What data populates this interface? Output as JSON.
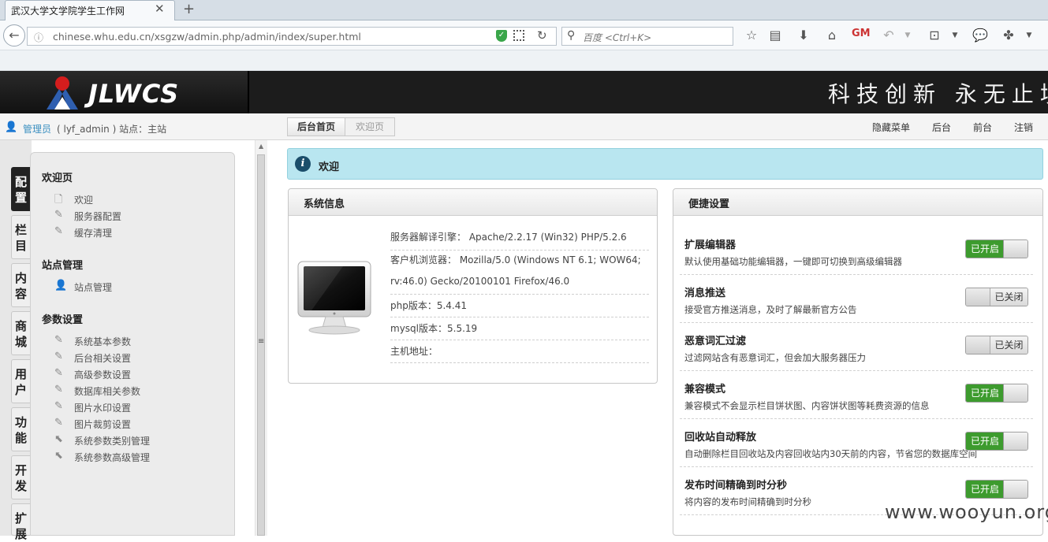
{
  "browser": {
    "tab_title": "武汉大学文学院学生工作网",
    "tab_close": "✕",
    "new_tab": "+",
    "url": "chinese.whu.edu.cn/xsgzw/admin.php/admin/index/super.html",
    "search_placeholder": "百度 <Ctrl+K>"
  },
  "header": {
    "logo_text": "JLWCS",
    "slogan": "科技创新 永无止境"
  },
  "infobar": {
    "user_role": "管理员",
    "user_rest": "( lyf_admin ) 站点：主站",
    "breadcrumb": [
      "后台首页",
      "欢迎页"
    ],
    "links": [
      "隐藏菜单",
      "后台",
      "前台",
      "注销"
    ]
  },
  "sidebar": {
    "tabs": [
      "配置",
      "栏目",
      "内容",
      "商城",
      "用户",
      "功能",
      "开发",
      "扩展"
    ],
    "sections": [
      {
        "title": "欢迎页",
        "items": [
          "欢迎",
          "服务器配置",
          "缓存清理"
        ]
      },
      {
        "title": "站点管理",
        "items": [
          "站点管理"
        ]
      },
      {
        "title": "参数设置",
        "items": [
          "系统基本参数",
          "后台相关设置",
          "高级参数设置",
          "数据库相关参数",
          "图片水印设置",
          "图片裁剪设置",
          "系统参数类别管理",
          "系统参数高级管理"
        ]
      }
    ]
  },
  "welcome": {
    "text": "欢迎"
  },
  "system_info": {
    "title": "系统信息",
    "lines": [
      "服务器解译引擎： Apache/2.2.17 (Win32) PHP/5.2.6",
      "客户机浏览器： Mozilla/5.0 (Windows NT 6.1; WOW64;",
      "rv:46.0) Gecko/20100101 Firefox/46.0",
      "php版本：5.4.41",
      "mysql版本：5.5.19",
      "主机地址："
    ]
  },
  "quick_settings": {
    "title": "便捷设置",
    "items": [
      {
        "title": "扩展编辑器",
        "desc": "默认使用基础功能编辑器，一键即可切换到高级编辑器",
        "state": "已开启",
        "on": true
      },
      {
        "title": "消息推送",
        "desc": "接受官方推送消息，及时了解最新官方公告",
        "state": "已关闭",
        "on": false
      },
      {
        "title": "恶意词汇过滤",
        "desc": "过滤网站含有恶意词汇，但会加大服务器压力",
        "state": "已关闭",
        "on": false
      },
      {
        "title": "兼容模式",
        "desc": "兼容模式不会显示栏目饼状图、内容饼状图等耗费资源的信息",
        "state": "已开启",
        "on": true
      },
      {
        "title": "回收站自动释放",
        "desc": "自动删除栏目回收站及内容回收站内30天前的内容，节省您的数据库空间",
        "state": "已开启",
        "on": true
      },
      {
        "title": "发布时间精确到时分秒",
        "desc": "将内容的发布时间精确到时分秒",
        "state": "已开启",
        "on": true
      }
    ]
  },
  "watermark": "www.wooyun.org"
}
